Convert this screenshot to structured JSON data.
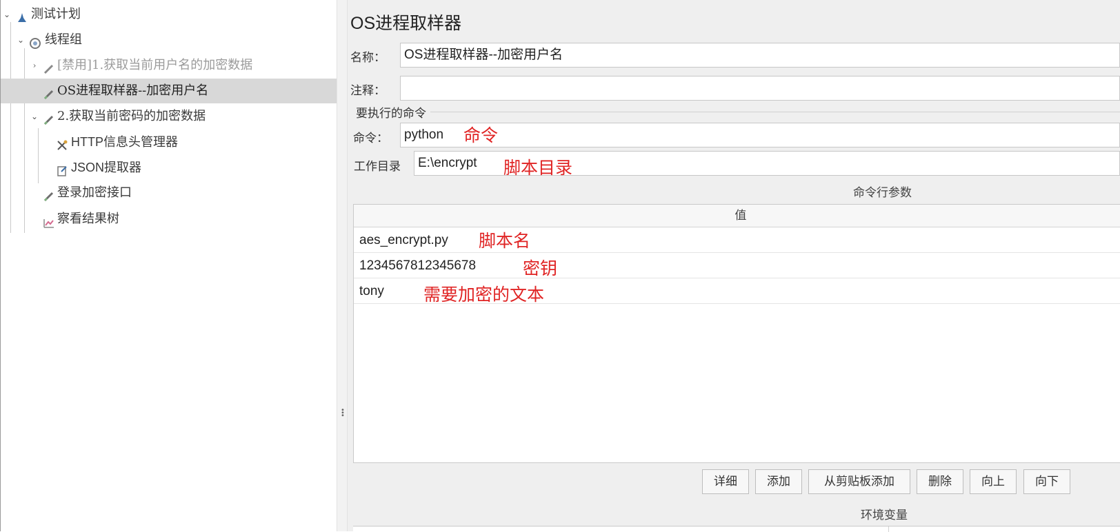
{
  "tree": {
    "nodes": [
      {
        "label": "测试计划",
        "icon": "test-plan-icon",
        "expander": "expanded"
      },
      {
        "label": "线程组",
        "icon": "thread-group-icon",
        "expander": "expanded"
      },
      {
        "label": "[禁用]1.获取当前用户名的加密数据",
        "icon": "sampler-pen-icon",
        "expander": "collapsed",
        "disabled": true
      },
      {
        "label": "OS进程取样器--加密用户名",
        "icon": "sampler-pen-icon",
        "selected": true
      },
      {
        "label": "2.获取当前密码的加密数据",
        "icon": "sampler-pen-icon",
        "expander": "expanded"
      },
      {
        "label": "HTTP信息头管理器",
        "icon": "header-manager-icon"
      },
      {
        "label": "JSON提取器",
        "icon": "json-extractor-icon"
      },
      {
        "label": "登录加密接口",
        "icon": "sampler-pen-icon"
      },
      {
        "label": "察看结果树",
        "icon": "results-tree-icon"
      }
    ]
  },
  "editor": {
    "title": "OS进程取样器",
    "name_label": "名称：",
    "name_value": "OS进程取样器--加密用户名",
    "comment_label": "注释：",
    "comment_value": "",
    "command_group": "要执行的命令",
    "command_label": "命令：",
    "command_value": "python",
    "workdir_label": "工作目录",
    "workdir_value": "E:\\encrypt",
    "args_title": "命令行参数",
    "args_column": "值",
    "args": [
      {
        "value": "aes_encrypt.py",
        "note": "脚本名"
      },
      {
        "value": "1234567812345678",
        "note": "密钥"
      },
      {
        "value": "tony",
        "note": "需要加密的文本"
      }
    ],
    "buttons": {
      "detail": "详细",
      "add": "添加",
      "add_clipboard": "从剪贴板添加",
      "delete": "删除",
      "up": "向上",
      "down": "向下"
    },
    "env_title": "环境变量"
  },
  "annotations": {
    "command": "命令",
    "workdir": "脚本目录"
  },
  "colors": {
    "annotation": "#e02424",
    "selected_row": "#d8d8d8",
    "panel_bg": "#efefef"
  }
}
